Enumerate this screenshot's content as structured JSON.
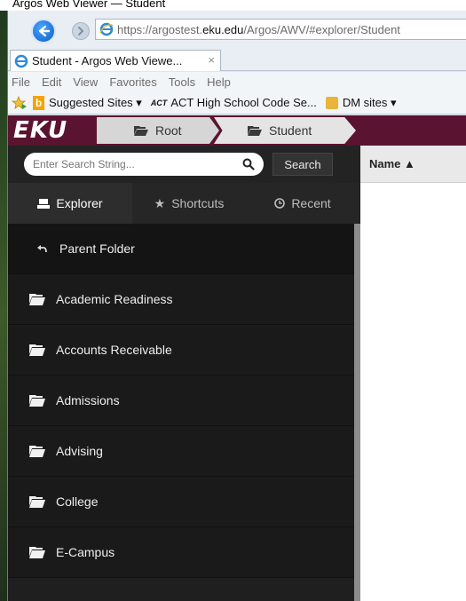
{
  "window": {
    "caption_clip": "Argos Web Viewer — Student"
  },
  "browser": {
    "url_prefix": "https://argostest.",
    "url_host": "eku.edu",
    "url_path": "/Argos/AWV/#explorer/Student",
    "tab_title": "Student - Argos Web Viewe...",
    "tab_close": "×",
    "menu": [
      "File",
      "Edit",
      "View",
      "Favorites",
      "Tools",
      "Help"
    ],
    "favorites": {
      "suggested": "Suggested Sites ▾",
      "act": "ACT High School Code Se...",
      "act_mark": "ACT",
      "dm": "DM sites ▾"
    }
  },
  "argos": {
    "logo": "EKU",
    "breadcrumb_root": "Root",
    "breadcrumb_student": "Student",
    "search_placeholder": "Enter Search String...",
    "search_button": "Search",
    "tabs": {
      "explorer": "Explorer",
      "shortcuts": "Shortcuts",
      "recent": "Recent"
    },
    "parent_folder": "Parent Folder",
    "folders": [
      "Academic Readiness",
      "Accounts Receivable",
      "Admissions",
      "Advising",
      "College",
      "E-Campus"
    ],
    "column_header": "Name ▲"
  },
  "colors": {
    "accent": "#5a1330",
    "sidebar_bg": "#1f1f1f"
  }
}
